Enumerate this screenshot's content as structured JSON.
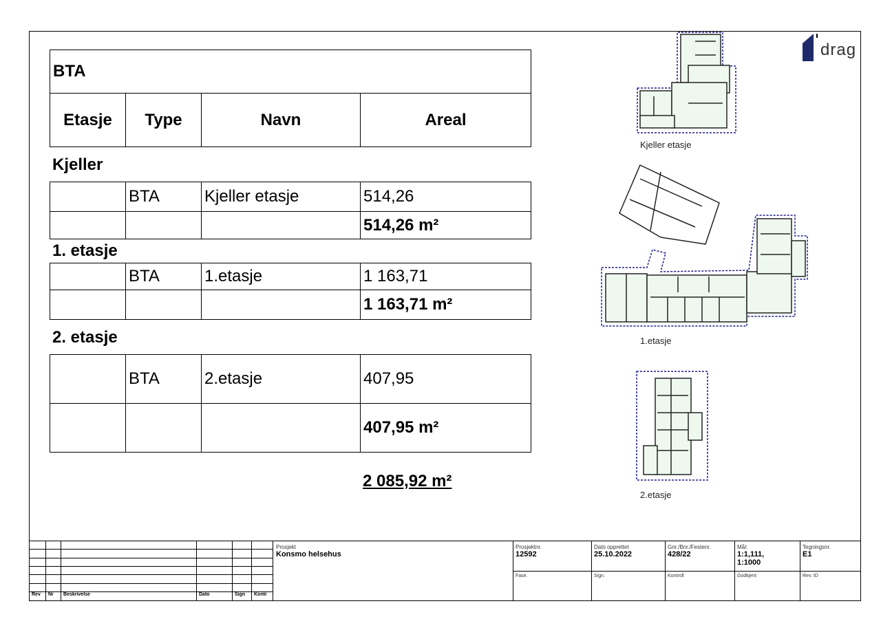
{
  "table": {
    "title": "BTA",
    "headers": [
      "Etasje",
      "Type",
      "Navn",
      "Areal"
    ],
    "sections": [
      {
        "label": "Kjeller",
        "type": "BTA",
        "name": "Kjeller etasje",
        "area": "514,26",
        "subtotal": "514,26 m²"
      },
      {
        "label": "1. etasje",
        "type": "BTA",
        "name": "1.etasje",
        "area": "1 163,71",
        "subtotal": "1 163,71 m²"
      },
      {
        "label": "2. etasje",
        "type": "BTA",
        "name": "2.etasje",
        "area": "407,95",
        "subtotal": "407,95 m²"
      }
    ],
    "total": "2 085,92 m²"
  },
  "plans": {
    "captions": [
      "Kjeller etasje",
      "1.etasje",
      "2.etasje"
    ],
    "outline_color": "#1a1a8c",
    "fill_color": "#eef8ee"
  },
  "logo": {
    "text": "drag",
    "color": "#1f2a6b"
  },
  "titleblock": {
    "rev_headers": [
      "Rev",
      "Nr",
      "Beskrivelse",
      "Dato",
      "Sign",
      "Kontr"
    ],
    "project_label": "Prosjekt",
    "project": "Konsmo helsehus",
    "fields": [
      {
        "label": "Prosjektnr.",
        "value": "12592"
      },
      {
        "label": "Dato opprettet",
        "value": "25.10.2022"
      },
      {
        "label": "Gnr./Bnr./Festenr.",
        "value": "428/22"
      },
      {
        "label": "Mål:",
        "value": "1:1,111, 1:1000"
      },
      {
        "label": "Tegningsnr.",
        "value": "E1"
      }
    ],
    "fields2": [
      "Fase.",
      "Sign.",
      "Kontroll",
      "Godkjent",
      "Rev. ID"
    ]
  }
}
